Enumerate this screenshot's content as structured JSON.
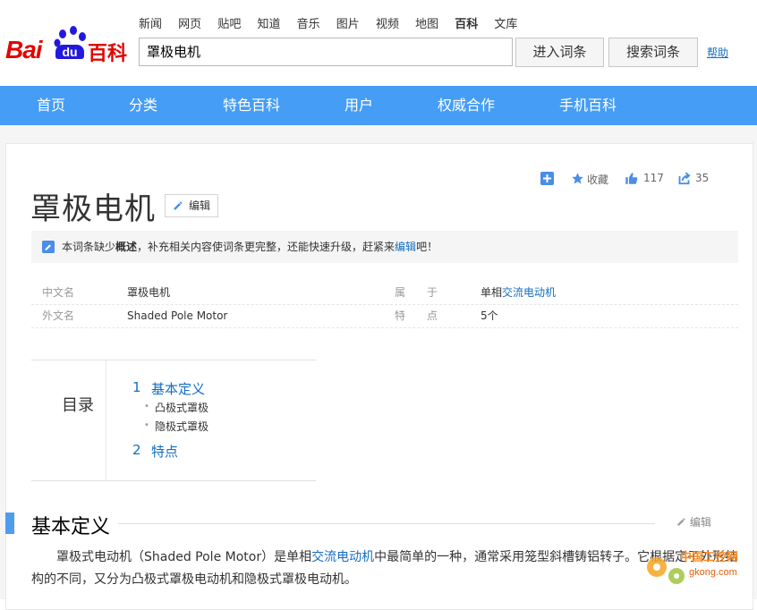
{
  "top_nav": {
    "items": [
      "新闻",
      "网页",
      "贴吧",
      "知道",
      "音乐",
      "图片",
      "视频",
      "地图",
      "百科",
      "文库"
    ],
    "active": "百科"
  },
  "logo": {
    "text_bai": "Bai",
    "text_du": "du",
    "text_baike": "百科"
  },
  "search": {
    "value": "罩极电机"
  },
  "buttons": {
    "enter": "进入词条",
    "search": "搜索词条",
    "help": "帮助"
  },
  "blue_nav": {
    "items": [
      "首页",
      "分类",
      "特色百科",
      "用户",
      "权威合作",
      "手机百科"
    ]
  },
  "tools": {
    "collect": "收藏",
    "like_count": "117",
    "share_count": "35"
  },
  "page": {
    "title": "罩极电机",
    "edit_label": "编辑"
  },
  "notice": {
    "prefix": "本词条缺少",
    "bold": "概述",
    "middle": "，补充相关内容使词条更完整，还能快速升级，赶紧来",
    "link": "编辑",
    "suffix": "吧！"
  },
  "info": {
    "row1": {
      "k1": "中文名",
      "v1": "罩极电机",
      "k2": "属　　于",
      "v2_prefix": "单相",
      "v2_link": "交流电动机"
    },
    "row2": {
      "k1": "外文名",
      "v1": "Shaded Pole Motor",
      "k2": "特　　点",
      "v2": "5个"
    }
  },
  "toc": {
    "label": "目录",
    "items": [
      {
        "num": "1",
        "text": "基本定义",
        "subs": [
          "凸极式罩极",
          "隐极式罩极"
        ]
      },
      {
        "num": "2",
        "text": "特点"
      }
    ]
  },
  "section": {
    "title": "基本定义",
    "edit": "编辑"
  },
  "paragraph": {
    "part1": "罩极式电动机（Shaded Pole Motor）是单相",
    "link": "交流电动机",
    "part2": "中最简单的一种，通常采用笼型斜槽铸铝转子。它根据定子外形结构的不同，又分为凸极式罩极电动机和隐极式罩极电动机。"
  },
  "watermark": {
    "site": "中国工控网",
    "domain": "gkong.com"
  },
  "colors": {
    "brand_red": "#e10601",
    "nav_blue": "#459df5",
    "link_blue": "#136ec2"
  }
}
